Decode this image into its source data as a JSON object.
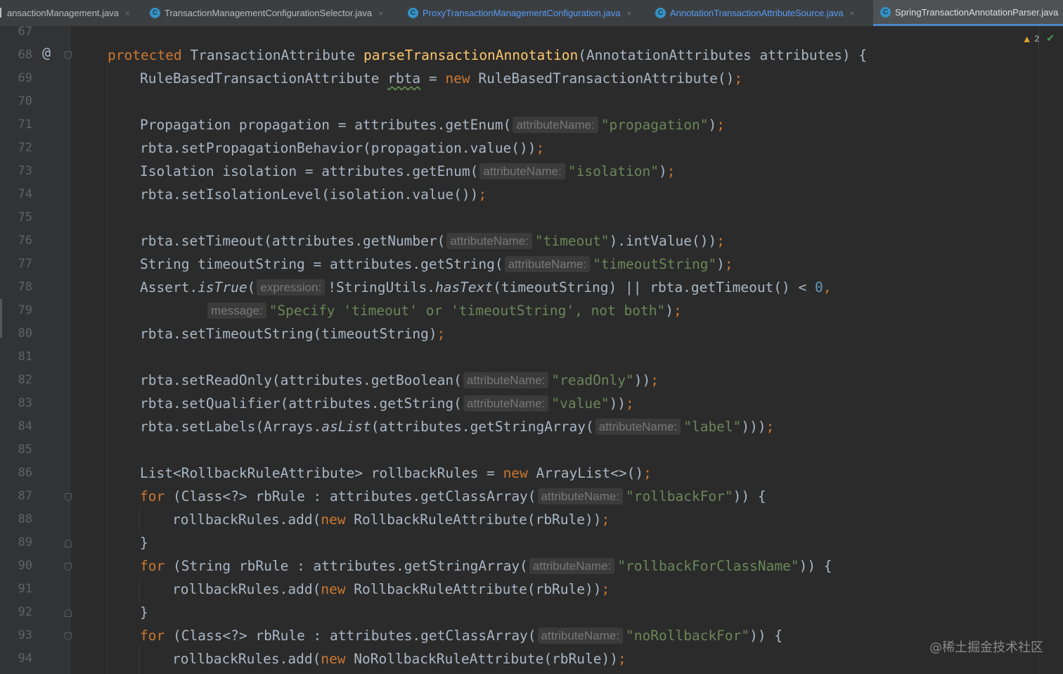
{
  "tabs": [
    {
      "label": "ansactionManagement.java",
      "has_icon": false,
      "active": false,
      "blue": false
    },
    {
      "label": "TransactionManagementConfigurationSelector.java",
      "has_icon": true,
      "active": false,
      "blue": false
    },
    {
      "label": "ProxyTransactionManagementConfiguration.java",
      "has_icon": true,
      "active": false,
      "blue": true
    },
    {
      "label": "AnnotationTransactionAttributeSource.java",
      "has_icon": true,
      "active": false,
      "blue": true
    },
    {
      "label": "SpringTransactionAnnotationParser.java",
      "has_icon": true,
      "active": true,
      "blue": false
    }
  ],
  "tab_close_glyph": "×",
  "tab_icon_letter": "C",
  "status": {
    "warning_count": "2",
    "warning_icon": "warning-triangle-icon",
    "check_icon": "check-icon"
  },
  "gutter": {
    "line_numbers": [
      "67",
      "68",
      "69",
      "70",
      "71",
      "72",
      "73",
      "74",
      "75",
      "76",
      "77",
      "78",
      "79",
      "80",
      "81",
      "82",
      "83",
      "84",
      "85",
      "86",
      "87",
      "88",
      "89",
      "90",
      "91",
      "92",
      "93",
      "94"
    ],
    "override_marker": "@"
  },
  "code": {
    "l68": {
      "kw": "protected",
      "type": " TransactionAttribute ",
      "fn": "parseTransactionAnnotation",
      "rest": "(AnnotationAttributes attributes) {"
    },
    "l69": {
      "a": "RuleBasedTransactionAttribute ",
      "var": "rbta",
      "b": " = ",
      "kw": "new",
      "c": " RuleBasedTransactionAttribute()",
      "semi": ";"
    },
    "l71": {
      "a": "Propagation propagation = attributes.getEnum(",
      "hint": "attributeName:",
      "str": "\"propagation\"",
      "b": ")",
      "semi": ";"
    },
    "l72": {
      "a": "rbta.setPropagationBehavior(propagation.value())",
      "semi": ";"
    },
    "l73": {
      "a": "Isolation isolation = attributes.getEnum(",
      "hint": "attributeName:",
      "str": "\"isolation\"",
      "b": ")",
      "semi": ";"
    },
    "l74": {
      "a": "rbta.setIsolationLevel(isolation.value())",
      "semi": ";"
    },
    "l76": {
      "a": "rbta.setTimeout(attributes.getNumber(",
      "hint": "attributeName:",
      "str": "\"timeout\"",
      "b": ").intValue())",
      "semi": ";"
    },
    "l77": {
      "a": "String timeoutString = attributes.getString(",
      "hint": "attributeName:",
      "str": "\"timeoutString\"",
      "b": ")",
      "semi": ";"
    },
    "l78": {
      "a": "Assert.",
      "it": "isTrue",
      "b": "(",
      "hint": "expression:",
      "c": "!StringUtils.",
      "it2": "hasText",
      "d": "(timeoutString) || rbta.getTimeout() < ",
      "num": "0",
      "e": ","
    },
    "l79": {
      "hint": "message:",
      "str": "\"Specify 'timeout' or 'timeoutString', not both\"",
      "b": ")",
      "semi": ";"
    },
    "l80": {
      "a": "rbta.setTimeoutString(timeoutString)",
      "semi": ";"
    },
    "l82": {
      "a": "rbta.setReadOnly(attributes.getBoolean(",
      "hint": "attributeName:",
      "str": "\"readOnly\"",
      "b": "))",
      "semi": ";"
    },
    "l83": {
      "a": "rbta.setQualifier(attributes.getString(",
      "hint": "attributeName:",
      "str": "\"value\"",
      "b": "))",
      "semi": ";"
    },
    "l84": {
      "a": "rbta.setLabels(Arrays.",
      "it": "asList",
      "b": "(attributes.getStringArray(",
      "hint": "attributeName:",
      "str": "\"label\"",
      "c": ")))",
      "semi": ";"
    },
    "l86": {
      "a": "List<RollbackRuleAttribute> rollbackRules = ",
      "kw": "new",
      "b": " ArrayList<>()",
      "semi": ";"
    },
    "l87": {
      "kw": "for",
      "a": " (Class<?> rbRule : attributes.getClassArray(",
      "hint": "attributeName:",
      "str": "\"rollbackFor\"",
      "b": ")) {"
    },
    "l88": {
      "a": "rollbackRules.add(",
      "kw": "new",
      "b": " RollbackRuleAttribute(rbRule))",
      "semi": ";"
    },
    "l89": {
      "a": "}"
    },
    "l90": {
      "kw": "for",
      "a": " (String rbRule : attributes.getStringArray(",
      "hint": "attributeName:",
      "str": "\"rollbackForClassName\"",
      "b": ")) {"
    },
    "l91": {
      "a": "rollbackRules.add(",
      "kw": "new",
      "b": " RollbackRuleAttribute(rbRule))",
      "semi": ";"
    },
    "l92": {
      "a": "}"
    },
    "l93": {
      "kw": "for",
      "a": " (Class<?> rbRule : attributes.getClassArray(",
      "hint": "attributeName:",
      "str": "\"noRollbackFor\"",
      "b": ")) {"
    },
    "l94": {
      "a": "rollbackRules.add(",
      "kw": "new",
      "b": " NoRollbackRuleAttribute(rbRule))",
      "semi": ";"
    }
  },
  "watermark": "@稀土掘金技术社区",
  "colors": {
    "keyword": "#cc7832",
    "function": "#ffc66d",
    "string": "#6a8759",
    "number": "#6897bb",
    "text": "#a9b7c6",
    "background": "#2b2b2b"
  }
}
